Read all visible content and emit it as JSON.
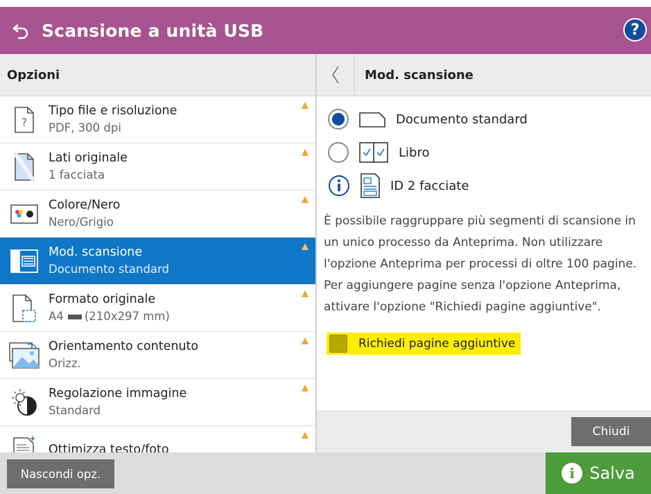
{
  "header": {
    "title": "Scansione a unità USB",
    "back_icon": "return-arrow-icon",
    "help_label": "?"
  },
  "colors": {
    "header_bg": "#a8538f",
    "selected_bg": "#0f77c8",
    "save_bg": "#4d9b3a",
    "warning": "#f2a533",
    "highlight": "#ffee00"
  },
  "options": {
    "title": "Opzioni",
    "items": [
      {
        "label": "Tipo file e risoluzione",
        "value": "PDF, 300 dpi",
        "icon": "file-question-icon"
      },
      {
        "label": "Lati originale",
        "value": "1 facciata",
        "icon": "page-sides-icon"
      },
      {
        "label": "Colore/Nero",
        "value": "Nero/Grigio",
        "icon": "color-black-icon"
      },
      {
        "label": "Mod. scansione",
        "value": "Documento standard",
        "icon": "book-scan-icon",
        "selected": true
      },
      {
        "label": "Formato originale",
        "value_prefix": "A4",
        "value_suffix": "(210x297 mm)",
        "icon": "page-format-icon"
      },
      {
        "label": "Orientamento contenuto",
        "value": "Orizz.",
        "icon": "orientation-icon"
      },
      {
        "label": "Regolazione immagine",
        "value": "Standard",
        "icon": "image-adjust-icon"
      },
      {
        "label": "Ottimizza testo/foto",
        "value": "",
        "icon": "optimize-text-photo-icon"
      }
    ]
  },
  "panel": {
    "title": "Mod. scansione",
    "choices": [
      {
        "label": "Documento standard",
        "selected": true
      },
      {
        "label": "Libro",
        "selected": false
      },
      {
        "label": "ID 2 facciate",
        "selected": false
      }
    ],
    "description": "È possibile raggruppare più segmenti di scansione in un unico processo da Anteprima. Non utilizzare l'opzione Anteprima per processi di oltre 100 pagine. Per aggiungere pagine senza l'opzione Anteprima, attivare l'opzione \"Richiedi pagine aggiuntive\".",
    "checkbox_label": "Richiedi pagine aggiuntive",
    "close_label": "Chiudi"
  },
  "footer": {
    "hide_label": "Nascondi opz.",
    "save_label": "Salva"
  }
}
